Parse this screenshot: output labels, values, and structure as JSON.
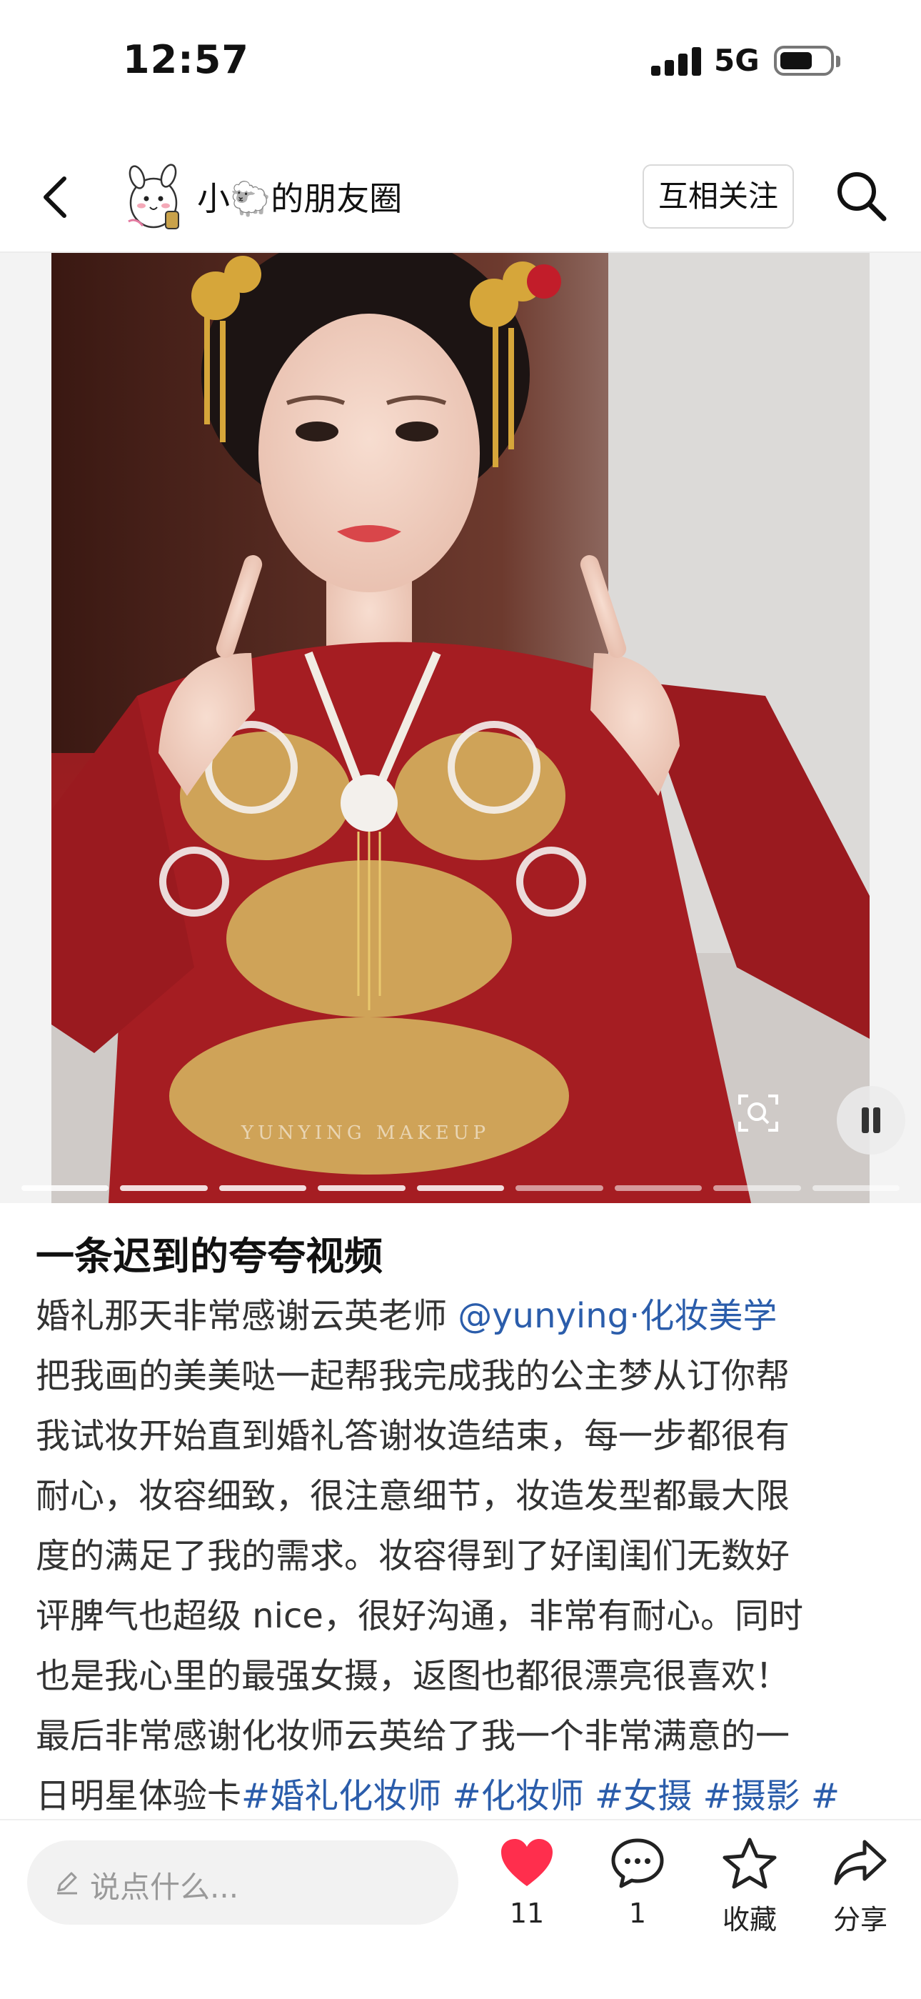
{
  "status_bar": {
    "time": "12:57",
    "network": "5G"
  },
  "nav": {
    "title": "小🐑的朋友圈",
    "follow_label": "互相关注"
  },
  "media": {
    "type": "video",
    "progress_segments": 9,
    "segments_done": 5
  },
  "post": {
    "title": "一条迟到的夸夸视频",
    "lines": [
      {
        "text": "婚礼那天非常感谢云英老师 ",
        "mention": "@yunying·化妆美学"
      },
      {
        "text": "把我画的美美哒一起帮我完成我的公主梦从订你帮"
      },
      {
        "text": "我试妆开始直到婚礼答谢妆造结束，每一步都很有"
      },
      {
        "text": "耐心，妆容细致，很注意细节，妆造发型都最大限"
      },
      {
        "text": "度的满足了我的需求。妆容得到了好闺闺们无数好"
      },
      {
        "text": "评脾气也超级 nice，很好沟通，非常有耐心。同时"
      },
      {
        "text": "也是我心里的最强女摄，返图也都很漂亮很喜欢！"
      },
      {
        "text": "最后非常感谢化妆师云英给了我一个非常满意的一"
      },
      {
        "text": "日明星体验卡",
        "hashtags": "#婚礼化妆师 #化妆师 #女摄 #摄影 #"
      }
    ]
  },
  "bottom_bar": {
    "comment_placeholder": "说点什么...",
    "like_count": "11",
    "comment_count": "1",
    "collect_label": "收藏",
    "share_label": "分享"
  },
  "colors": {
    "like": "#ff2e4d",
    "link": "#2b5dab",
    "dress": "#a51d22"
  },
  "icons": [
    "back-icon",
    "search-icon",
    "pause-icon",
    "scan-icon",
    "pen-icon",
    "heart-icon",
    "comment-icon",
    "star-icon",
    "share-icon"
  ]
}
